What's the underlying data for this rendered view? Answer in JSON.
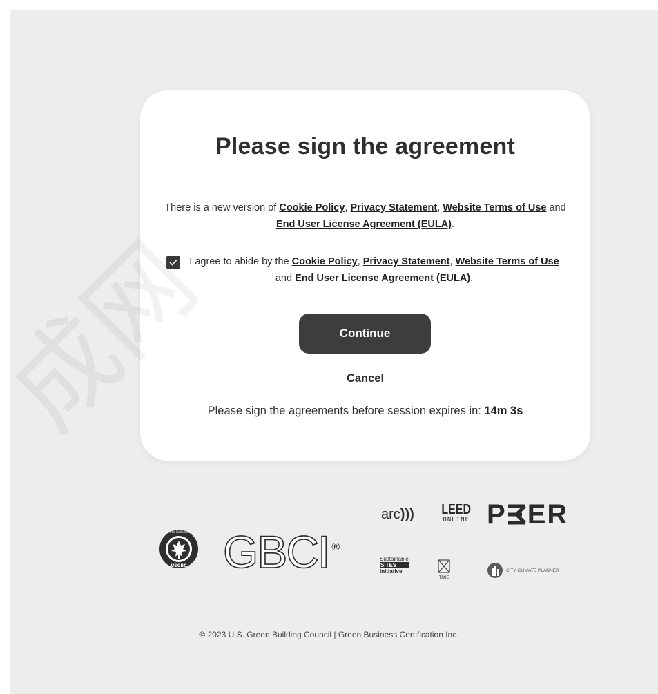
{
  "dialog": {
    "title": "Please sign the agreement",
    "notice": {
      "prefix": "There is a new version of ",
      "links": [
        "Cookie Policy",
        "Privacy Statement",
        "Website Terms of Use",
        "End User License Agreement (EULA)"
      ],
      "sep1": ", ",
      "sep2": ", ",
      "sep3": " and ",
      "suffix": "."
    },
    "agreement": {
      "checked": true,
      "prefix": "I agree to abide by the ",
      "links": [
        "Cookie Policy",
        "Privacy Statement",
        "Website Terms of Use",
        "End User License Agreement (EULA)"
      ],
      "sep1": ", ",
      "sep2": ", ",
      "sep3": " and ",
      "suffix": "."
    },
    "continue_label": "Continue",
    "cancel_label": "Cancel",
    "session": {
      "text": "Please sign the agreements before session expires in: ",
      "time": "14m 3s"
    }
  },
  "logos": {
    "usgbc": "USGBC",
    "usgbc_ring": "U.S. GREEN BUILDING COUNCIL",
    "gbci": "GBCI",
    "gbci_mark": "®",
    "arc": "arc",
    "leed_top": "LEED",
    "leed_bottom": "ONLINE",
    "peer": "P",
    "peer_rest": "ER",
    "sites_line1": "Sustainable",
    "sites_line2": "SITES",
    "sites_line3": "Initiative",
    "true": "TRUE",
    "city": "CITY CLIMATE PLANNER"
  },
  "footer": "© 2023 U.S. Green Building Council | Green Business Certification Inc.",
  "watermark": "成网",
  "colors": {
    "button_bg": "#3d3d3d",
    "page_bg": "#ededed",
    "card_bg": "#ffffff"
  }
}
